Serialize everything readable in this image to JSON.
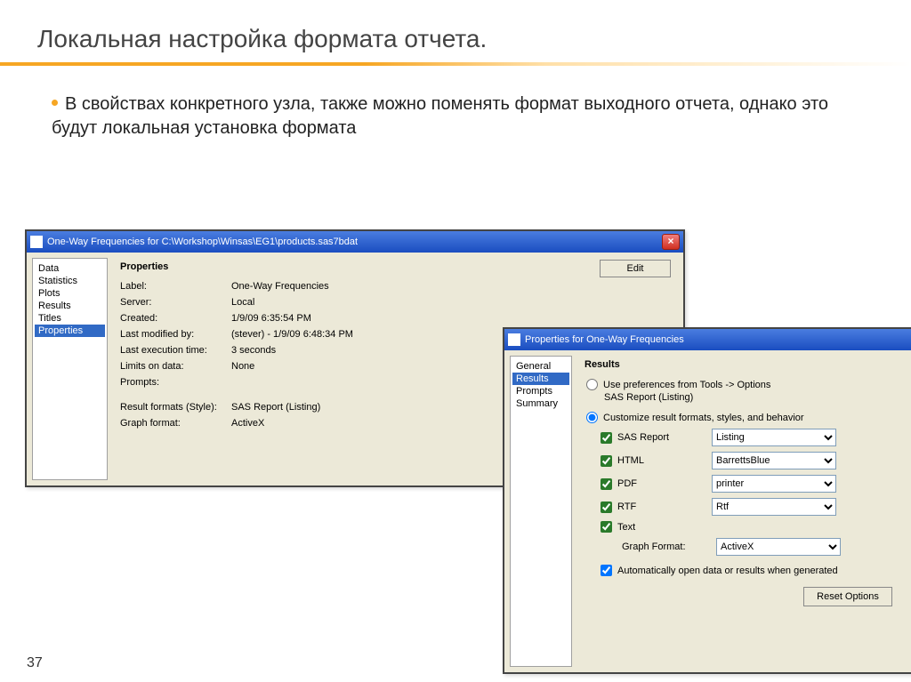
{
  "slide": {
    "title": "Локальная настройка формата отчета.",
    "bullet": "В свойствах конкретного узла, также можно поменять формат выходного отчета, однако это будут локальная установка формата",
    "page_number": "37"
  },
  "win1": {
    "title": "One-Way Frequencies for C:\\Workshop\\Winsas\\EG1\\products.sas7bdat",
    "side": {
      "items": [
        "Data",
        "Statistics",
        "Plots",
        "Results",
        "Titles",
        "Properties"
      ],
      "selected": 5
    },
    "panel_title": "Properties",
    "edit_btn": "Edit",
    "rows": [
      {
        "label": "Label:",
        "value": "One-Way Frequencies"
      },
      {
        "label": "Server:",
        "value": "Local"
      },
      {
        "label": "Created:",
        "value": "1/9/09 6:35:54 PM"
      },
      {
        "label": "Last modified by:",
        "value": "(stever) - 1/9/09 6:48:34 PM"
      },
      {
        "label": "Last execution time:",
        "value": "3 seconds"
      },
      {
        "label": "Limits on data:",
        "value": "None"
      },
      {
        "label": "Prompts:",
        "value": ""
      }
    ],
    "rows2": [
      {
        "label": "Result formats (Style):",
        "value": "SAS Report (Listing)"
      },
      {
        "label": "Graph format:",
        "value": "ActiveX"
      }
    ]
  },
  "win2": {
    "title": "Properties for One-Way Frequencies",
    "side": {
      "items": [
        "General",
        "Results",
        "Prompts",
        "Summary"
      ],
      "selected": 1
    },
    "panel_title": "Results",
    "radio1": "Use preferences from Tools -> Options",
    "radio1_sub": "SAS Report (Listing)",
    "radio2": "Customize result formats, styles, and behavior",
    "formats": [
      {
        "label": "SAS Report",
        "value": "Listing",
        "checked": true
      },
      {
        "label": "HTML",
        "value": "BarrettsBlue",
        "checked": true
      },
      {
        "label": "PDF",
        "value": "printer",
        "checked": true
      },
      {
        "label": "RTF",
        "value": "Rtf",
        "checked": true
      },
      {
        "label": "Text",
        "value": "",
        "checked": true
      }
    ],
    "graph_label": "Graph Format:",
    "graph_value": "ActiveX",
    "auto_open": "Automatically open data or results when generated",
    "reset": "Reset Options"
  }
}
